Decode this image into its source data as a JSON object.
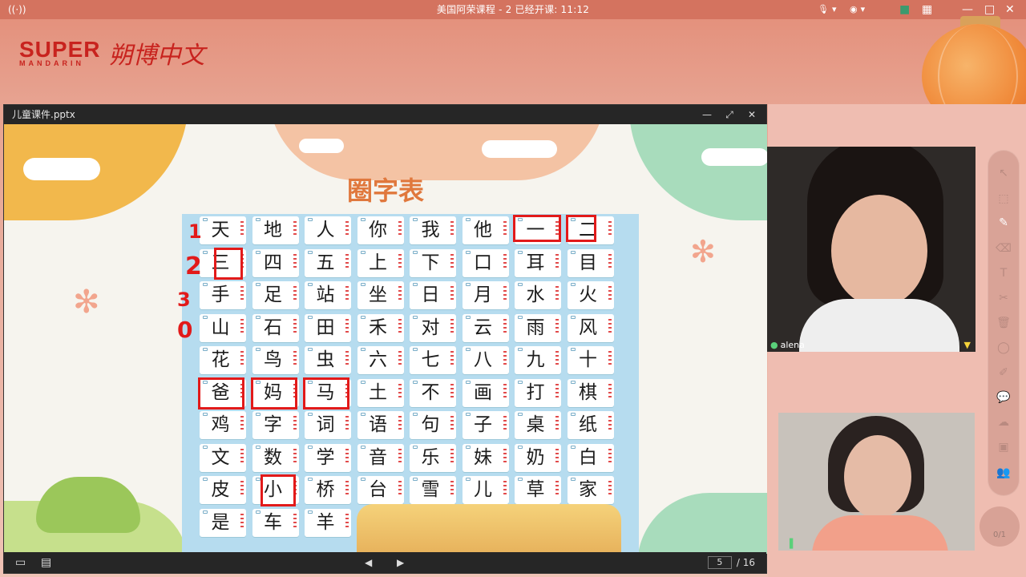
{
  "window": {
    "title": "美国阿荣课程 - 2   已经开课: 11:12",
    "live_icon": "((·))"
  },
  "brand": {
    "en": "SUPER",
    "en_sub": "MANDARIN",
    "cn": "朔博中文"
  },
  "viewer": {
    "filename": "儿童课件.pptx",
    "page_current": "5",
    "page_total": "/ 16"
  },
  "slide": {
    "title": "圈字表",
    "annotation_numbers": [
      "1",
      "2",
      "3",
      "0"
    ],
    "rows": [
      [
        "天",
        "地",
        "人",
        "你",
        "我",
        "他",
        "一",
        "二"
      ],
      [
        "三",
        "四",
        "五",
        "上",
        "下",
        "口",
        "耳",
        "目"
      ],
      [
        "手",
        "足",
        "站",
        "坐",
        "日",
        "月",
        "水",
        "火"
      ],
      [
        "山",
        "石",
        "田",
        "禾",
        "对",
        "云",
        "雨",
        "风"
      ],
      [
        "花",
        "鸟",
        "虫",
        "六",
        "七",
        "八",
        "九",
        "十"
      ],
      [
        "爸",
        "妈",
        "马",
        "土",
        "不",
        "画",
        "打",
        "棋"
      ],
      [
        "鸡",
        "字",
        "词",
        "语",
        "句",
        "子",
        "桌",
        "纸"
      ],
      [
        "文",
        "数",
        "学",
        "音",
        "乐",
        "妹",
        "奶",
        "白"
      ],
      [
        "皮",
        "小",
        "桥",
        "台",
        "雪",
        "儿",
        "草",
        "家"
      ],
      [
        "是",
        "车",
        "羊"
      ]
    ],
    "circled": [
      "一",
      "二",
      "三",
      "爸",
      "妈",
      "马",
      "小"
    ]
  },
  "participants": [
    {
      "name": "alena",
      "icon": "mic-icon"
    },
    {
      "name": "",
      "icon": "mic-icon"
    }
  ],
  "toolbar": {
    "tools": [
      "pointer",
      "select",
      "pen",
      "eraser",
      "text",
      "scissors",
      "trash",
      "shape",
      "edit",
      "comment",
      "cloud",
      "box",
      "users"
    ],
    "counter": "0/1"
  },
  "colors": {
    "accent": "#e21a1a",
    "title_orange": "#e0783d",
    "bar": "#262626"
  }
}
